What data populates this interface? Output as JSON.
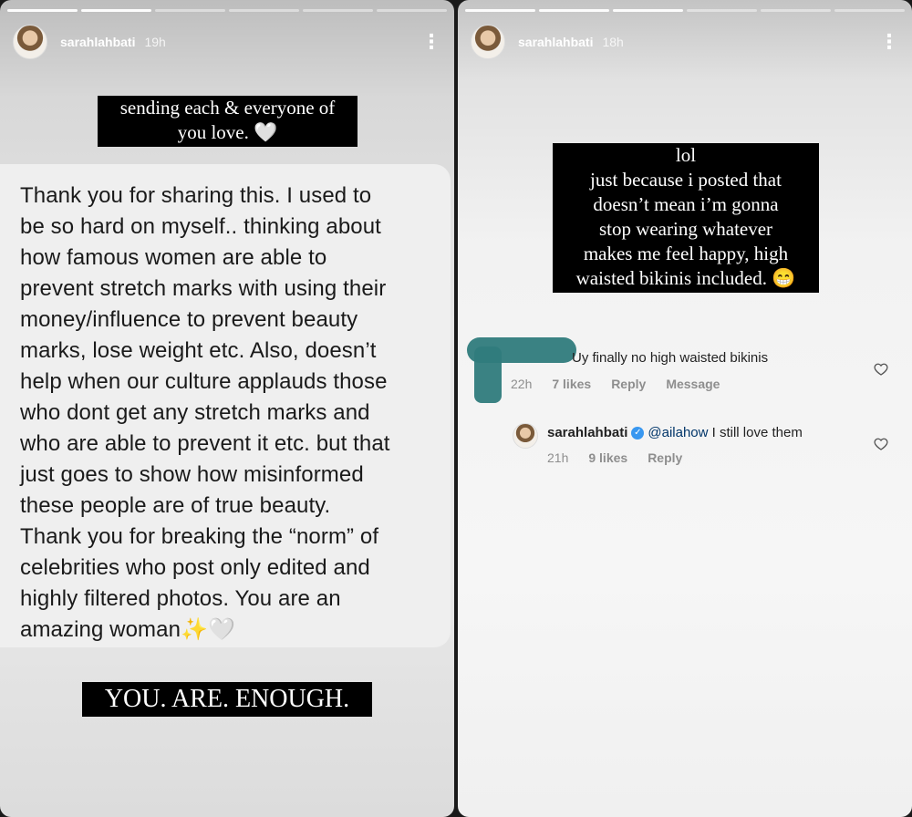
{
  "left_story": {
    "username": "sarahlahbati",
    "time": "19h",
    "top_caption": "sending each & everyone of\nyou love. 🤍",
    "quote_text": "Thank you for sharing this. I used to\nbe so hard on myself.. thinking about\nhow famous women are able to\nprevent stretch marks with using their\nmoney/influence to prevent beauty\nmarks, lose weight etc. Also, doesn’t\nhelp when our culture applauds those\nwho dont get any stretch marks and\nwho are able to prevent it etc. but that\njust goes to show how misinformed\nthese people are of true beauty.\nThank you for breaking the “norm” of\ncelebrities who post only edited and\nhighly filtered photos. You are an\namazing woman✨🤍",
    "bottom_caption": "YOU. ARE. ENOUGH."
  },
  "right_story": {
    "username": "sarahlahbati",
    "time": "18h",
    "caption": "lol\njust because i posted that\ndoesn’t mean i’m gonna\nstop wearing whatever\nmakes me feel happy, high\nwaisted bikinis included. 😁",
    "comment": {
      "text": "Uy finally no high waisted bikinis",
      "time": "22h",
      "likes": "7 likes",
      "reply": "Reply",
      "message": "Message"
    },
    "reply": {
      "username": "sarahlahbati",
      "mention": "@ailahow",
      "text": " I still love them",
      "time": "21h",
      "likes": "9 likes",
      "reply": "Reply"
    }
  },
  "icons": {
    "more": "⋮",
    "verified": "✓"
  },
  "colors": {
    "caption_bg": "#000000",
    "redaction": "#2f7b7c",
    "mention": "#003569"
  }
}
